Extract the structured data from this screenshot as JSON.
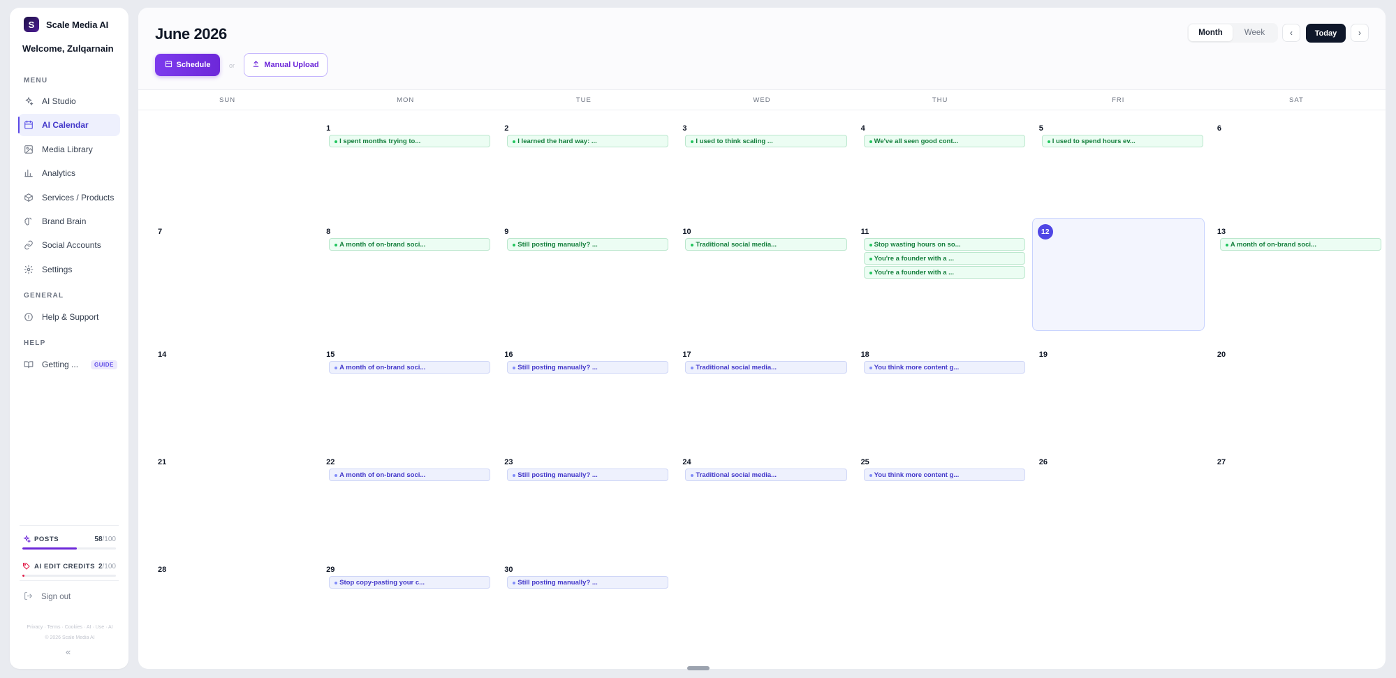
{
  "app": {
    "name": "Scale Media AI",
    "logo_letter": "S",
    "welcome": "Welcome, Zulqarnain"
  },
  "sidebar": {
    "menu_label": "MENU",
    "general_label": "GENERAL",
    "help_label": "HELP",
    "menu_items": [
      {
        "label": "AI Studio",
        "icon": "sparkle-icon",
        "active": false
      },
      {
        "label": "AI Calendar",
        "icon": "calendar-icon",
        "active": true
      },
      {
        "label": "Media Library",
        "icon": "image-icon",
        "active": false
      },
      {
        "label": "Analytics",
        "icon": "bar-chart-icon",
        "active": false
      },
      {
        "label": "Services / Products",
        "icon": "box-icon",
        "active": false
      },
      {
        "label": "Brand Brain",
        "icon": "brain-icon",
        "active": false
      },
      {
        "label": "Social Accounts",
        "icon": "link-icon",
        "active": false
      },
      {
        "label": "Settings",
        "icon": "gear-icon",
        "active": false
      }
    ],
    "general_items": [
      {
        "label": "Help & Support",
        "icon": "info-icon"
      }
    ],
    "help_items": [
      {
        "label": "Getting ...",
        "icon": "book-icon",
        "badge": "GUIDE"
      }
    ],
    "credits": [
      {
        "label": "POSTS",
        "used": "58",
        "max": "/100",
        "fraction": 0.58,
        "color": "#6d28d9"
      },
      {
        "label": "AI EDIT CREDITS",
        "used": "2",
        "max": "/100",
        "fraction": 0.02,
        "color": "#e11d48"
      }
    ],
    "signout": "Sign out",
    "legal_line1": "Privacy · Terms · Cookies · AI · Use · AI",
    "legal_line2": "© 2026 Scale Media AI",
    "collapse_glyph": "«"
  },
  "header": {
    "month_title": "June 2026",
    "schedule_label": "Schedule",
    "or_text": "or",
    "upload_label": "Manual Upload",
    "view_month": "Month",
    "view_week": "Week",
    "prev_glyph": "‹",
    "next_glyph": "›",
    "today_label": "Today"
  },
  "calendar": {
    "weekdays": [
      "SUN",
      "MON",
      "TUE",
      "WED",
      "THU",
      "FRI",
      "SAT"
    ],
    "today": 12,
    "weeks": [
      [
        {
          "day": ""
        },
        {
          "day": "1",
          "events": [
            {
              "text": "I spent months trying to...",
              "kind": "green"
            }
          ]
        },
        {
          "day": "2",
          "events": [
            {
              "text": "I learned the hard way: ...",
              "kind": "green"
            }
          ]
        },
        {
          "day": "3",
          "events": [
            {
              "text": "I used to think scaling ...",
              "kind": "green"
            }
          ]
        },
        {
          "day": "4",
          "events": [
            {
              "text": "We've all seen good cont...",
              "kind": "green"
            }
          ]
        },
        {
          "day": "5",
          "events": [
            {
              "text": "I used to spend hours ev...",
              "kind": "green"
            }
          ]
        },
        {
          "day": "6"
        }
      ],
      [
        {
          "day": "7"
        },
        {
          "day": "8",
          "events": [
            {
              "text": "A month of on-brand soci...",
              "kind": "green"
            }
          ]
        },
        {
          "day": "9",
          "events": [
            {
              "text": "Still posting manually? ...",
              "kind": "green"
            }
          ]
        },
        {
          "day": "10",
          "events": [
            {
              "text": "Traditional social media...",
              "kind": "green"
            }
          ]
        },
        {
          "day": "11",
          "events": [
            {
              "text": "Stop wasting hours on so...",
              "kind": "green"
            },
            {
              "text": "You're a founder with a ...",
              "kind": "green"
            },
            {
              "text": "You're a founder with a ...",
              "kind": "green"
            }
          ]
        },
        {
          "day": "12"
        },
        {
          "day": "13",
          "events": [
            {
              "text": "A month of on-brand soci...",
              "kind": "green"
            }
          ]
        }
      ],
      [
        {
          "day": "14"
        },
        {
          "day": "15",
          "events": [
            {
              "text": "A month of on-brand soci...",
              "kind": "purple"
            }
          ]
        },
        {
          "day": "16",
          "events": [
            {
              "text": "Still posting manually? ...",
              "kind": "purple"
            }
          ]
        },
        {
          "day": "17",
          "events": [
            {
              "text": "Traditional social media...",
              "kind": "purple"
            }
          ]
        },
        {
          "day": "18",
          "events": [
            {
              "text": "You think more content g...",
              "kind": "purple"
            }
          ]
        },
        {
          "day": "19"
        },
        {
          "day": "20"
        }
      ],
      [
        {
          "day": "21"
        },
        {
          "day": "22",
          "events": [
            {
              "text": "A month of on-brand soci...",
              "kind": "purple"
            }
          ]
        },
        {
          "day": "23",
          "events": [
            {
              "text": "Still posting manually? ...",
              "kind": "purple"
            }
          ]
        },
        {
          "day": "24",
          "events": [
            {
              "text": "Traditional social media...",
              "kind": "purple"
            }
          ]
        },
        {
          "day": "25",
          "events": [
            {
              "text": "You think more content g...",
              "kind": "purple"
            }
          ]
        },
        {
          "day": "26"
        },
        {
          "day": "27"
        }
      ],
      [
        {
          "day": "28"
        },
        {
          "day": "29",
          "events": [
            {
              "text": "Stop copy-pasting your c...",
              "kind": "purple"
            }
          ]
        },
        {
          "day": "30",
          "events": [
            {
              "text": "Still posting manually? ...",
              "kind": "purple"
            }
          ]
        },
        {
          "day": ""
        },
        {
          "day": ""
        },
        {
          "day": ""
        },
        {
          "day": ""
        }
      ]
    ]
  }
}
